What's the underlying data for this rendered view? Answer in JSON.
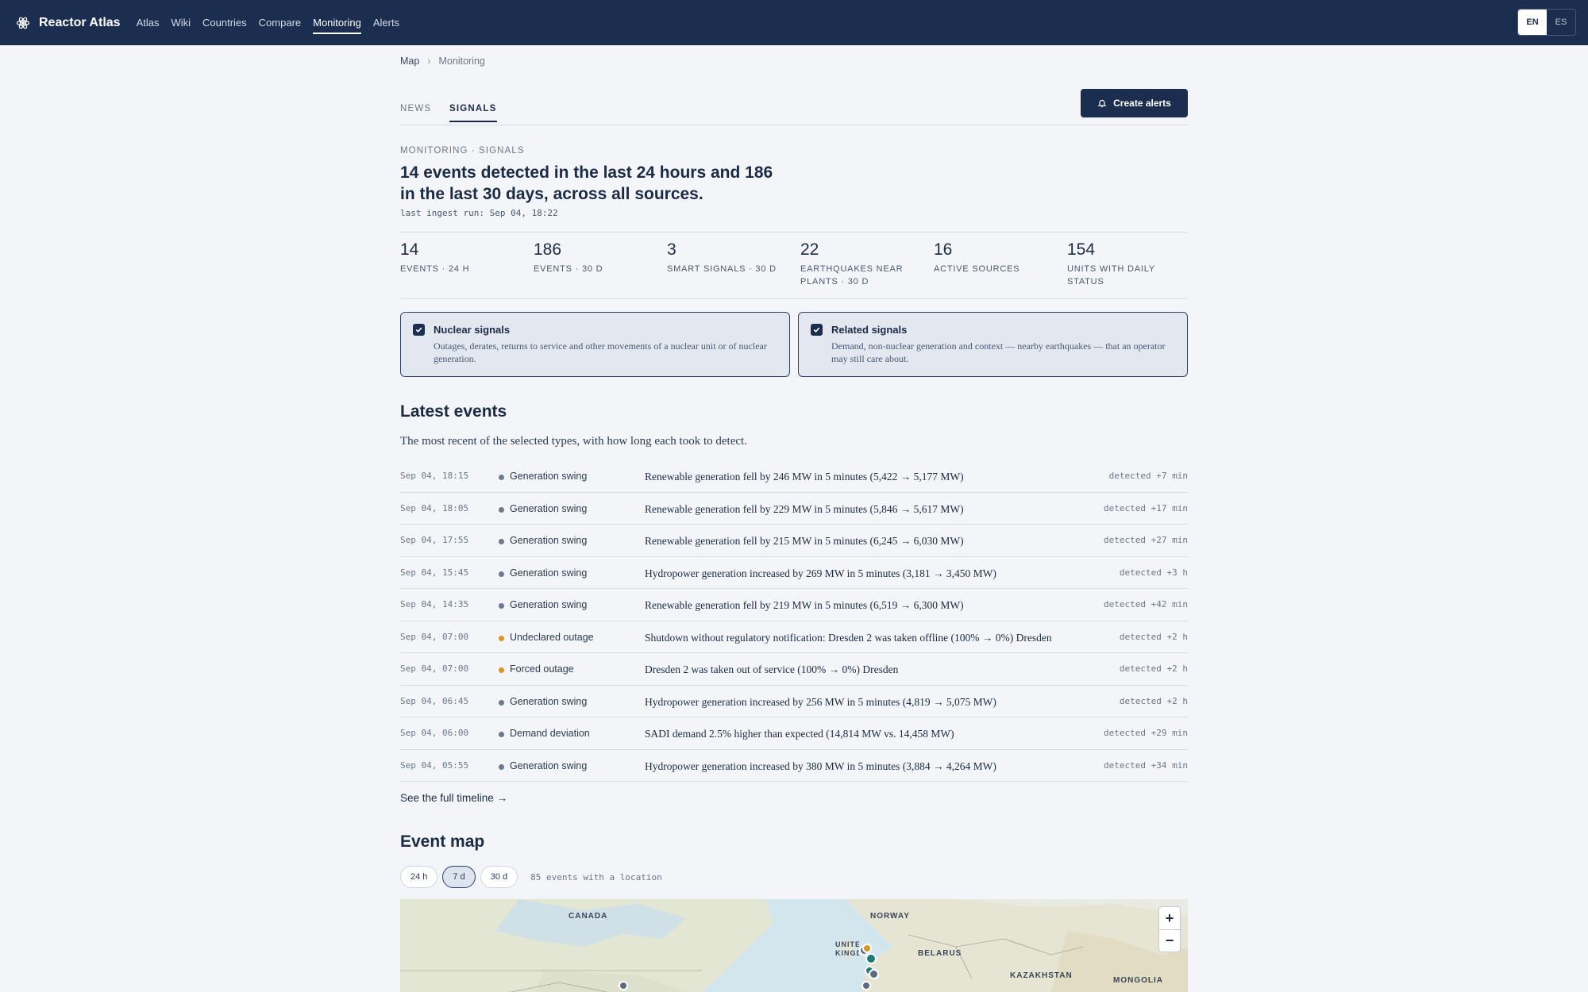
{
  "brand": {
    "name": "Reactor Atlas",
    "icon": "atom-icon"
  },
  "nav": [
    {
      "label": "Atlas",
      "active": false
    },
    {
      "label": "Wiki",
      "active": false
    },
    {
      "label": "Countries",
      "active": false
    },
    {
      "label": "Compare",
      "active": false
    },
    {
      "label": "Monitoring",
      "active": true
    },
    {
      "label": "Alerts",
      "active": false
    }
  ],
  "lang": {
    "en": "EN",
    "es": "ES",
    "selected": "EN"
  },
  "breadcrumb": {
    "root": "Map",
    "current": "Monitoring"
  },
  "tabs": [
    {
      "label": "NEWS",
      "active": false
    },
    {
      "label": "SIGNALS",
      "active": true
    }
  ],
  "create_alerts": {
    "label": "Create alerts",
    "icon": "bell-icon"
  },
  "header": {
    "eyebrow": "MONITORING · SIGNALS",
    "headline": "14 events detected in the last 24 hours and 186 in the last 30 days, across all sources.",
    "ingest": "last ingest run: Sep 04, 18:22"
  },
  "stats": [
    {
      "value": "14",
      "label": "EVENTS · 24 H"
    },
    {
      "value": "186",
      "label": "EVENTS · 30 D"
    },
    {
      "value": "3",
      "label": "SMART SIGNALS · 30 D"
    },
    {
      "value": "22",
      "label": "EARTHQUAKES NEAR PLANTS · 30 D"
    },
    {
      "value": "16",
      "label": "ACTIVE SOURCES"
    },
    {
      "value": "154",
      "label": "UNITS WITH DAILY STATUS"
    }
  ],
  "filters": [
    {
      "title": "Nuclear signals",
      "desc": "Outages, derates, returns to service and other movements of a nuclear unit or of nuclear generation.",
      "checked": true
    },
    {
      "title": "Related signals",
      "desc": "Demand, non-nuclear generation and context — nearby earthquakes — that an operator may still care about.",
      "checked": true
    }
  ],
  "latest": {
    "title": "Latest events",
    "desc": "The most recent of the selected types, with how long each took to detect.",
    "rows": [
      {
        "time": "Sep 04, 18:15",
        "type": "Generation swing",
        "color": "#6b7a90",
        "desc": "Renewable generation fell by 246 MW in 5 minutes (5,422 → 5,177 MW)",
        "detected": "detected +7 min"
      },
      {
        "time": "Sep 04, 18:05",
        "type": "Generation swing",
        "color": "#6b7a90",
        "desc": "Renewable generation fell by 229 MW in 5 minutes (5,846 → 5,617 MW)",
        "detected": "detected +17 min"
      },
      {
        "time": "Sep 04, 17:55",
        "type": "Generation swing",
        "color": "#6b7a90",
        "desc": "Renewable generation fell by 215 MW in 5 minutes (6,245 → 6,030 MW)",
        "detected": "detected +27 min"
      },
      {
        "time": "Sep 04, 15:45",
        "type": "Generation swing",
        "color": "#6b7a90",
        "desc": "Hydropower generation increased by 269 MW in 5 minutes (3,181 → 3,450 MW)",
        "detected": "detected +3 h"
      },
      {
        "time": "Sep 04, 14:35",
        "type": "Generation swing",
        "color": "#6b7a90",
        "desc": "Renewable generation fell by 219 MW in 5 minutes (6,519 → 6,300 MW)",
        "detected": "detected +42 min"
      },
      {
        "time": "Sep 04, 07:00",
        "type": "Undeclared outage",
        "color": "#d4962a",
        "desc": "Shutdown without regulatory notification: Dresden 2 was taken offline (100% → 0%) Dresden",
        "detected": "detected +2 h"
      },
      {
        "time": "Sep 04, 07:00",
        "type": "Forced outage",
        "color": "#d4962a",
        "desc": "Dresden 2 was taken out of service (100% → 0%) Dresden",
        "detected": "detected +2 h"
      },
      {
        "time": "Sep 04, 06:45",
        "type": "Generation swing",
        "color": "#6b7a90",
        "desc": "Hydropower generation increased by 256 MW in 5 minutes (4,819 → 5,075 MW)",
        "detected": "detected +2 h"
      },
      {
        "time": "Sep 04, 06:00",
        "type": "Demand deviation",
        "color": "#6b7a90",
        "desc": "SADI demand 2.5% higher than expected (14,814 MW vs. 14,458 MW)",
        "detected": "detected +29 min"
      },
      {
        "time": "Sep 04, 05:55",
        "type": "Generation swing",
        "color": "#6b7a90",
        "desc": "Hydropower generation increased by 380 MW in 5 minutes (3,884 → 4,264 MW)",
        "detected": "detected +34 min"
      }
    ],
    "link": "See the full timeline →"
  },
  "event_map": {
    "title": "Event map",
    "ranges": [
      {
        "label": "24 h",
        "active": false
      },
      {
        "label": "7 d",
        "active": true
      },
      {
        "label": "30 d",
        "active": false
      }
    ],
    "info": "85 events with a location",
    "labels": [
      "CANADA",
      "NORWAY",
      "UNITED KINGDOM",
      "BELARUS",
      "KAZAKHSTAN",
      "MONGOLIA"
    ],
    "zoom_in": "+",
    "zoom_out": "−",
    "colors": {
      "teal": "#1f7a7a",
      "amber": "#d4962a",
      "slate": "#5d6b80"
    }
  }
}
